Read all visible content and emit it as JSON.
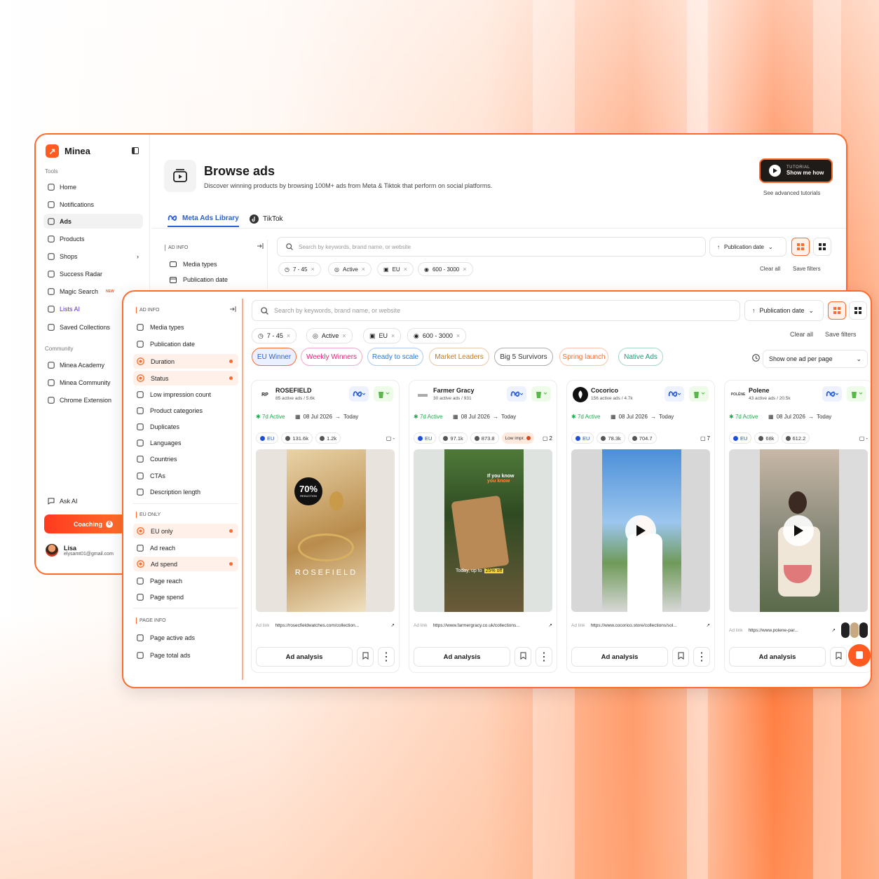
{
  "app": {
    "name": "Minea",
    "sections": {
      "tools": "Tools",
      "community": "Community"
    }
  },
  "sidebar": {
    "tools": [
      {
        "label": "Home",
        "icon": "home-icon"
      },
      {
        "label": "Notifications",
        "icon": "bell-icon"
      },
      {
        "label": "Ads",
        "icon": "ads-icon",
        "active": true
      },
      {
        "label": "Products",
        "icon": "box-icon"
      },
      {
        "label": "Shops",
        "icon": "shop-icon"
      },
      {
        "label": "Success Radar",
        "icon": "radar-icon"
      },
      {
        "label": "Magic Search",
        "icon": "wand-icon",
        "badge": "NEW"
      },
      {
        "label": "Lists AI",
        "icon": "sparkle-icon"
      },
      {
        "label": "Saved Collections",
        "icon": "collection-icon"
      }
    ],
    "community": [
      {
        "label": "Minea Academy",
        "icon": "academy-icon"
      },
      {
        "label": "Minea Community",
        "icon": "people-icon"
      },
      {
        "label": "Chrome Extension",
        "icon": "chrome-icon"
      }
    ],
    "ask_ai": "Ask AI",
    "coaching": "Coaching",
    "coaching_count": "0",
    "user": {
      "name": "Lisa",
      "email": "elysamt01@gmail.com"
    }
  },
  "header": {
    "title": "Browse ads",
    "subtitle": "Discover winning products by browsing 100M+ ads from Meta & Tiktok that perform on social platforms.",
    "tutorial_small": "TUTORIAL",
    "tutorial_big": "Show me how",
    "see_tutorials": "See advanced tutorials"
  },
  "tabs": [
    {
      "label": "Meta Ads Library",
      "active": true
    },
    {
      "label": "TikTok",
      "active": false
    }
  ],
  "filters": {
    "ad_info_title": "AD INFO",
    "ad_info": [
      {
        "label": "Media types",
        "on": false
      },
      {
        "label": "Publication date",
        "on": false
      },
      {
        "label": "Duration",
        "on": true
      },
      {
        "label": "Status",
        "on": true
      },
      {
        "label": "Low impression count",
        "on": false
      },
      {
        "label": "Product categories",
        "on": false
      },
      {
        "label": "Duplicates",
        "on": false
      },
      {
        "label": "Languages",
        "on": false
      },
      {
        "label": "Countries",
        "on": false
      },
      {
        "label": "CTAs",
        "on": false
      },
      {
        "label": "Description length",
        "on": false
      }
    ],
    "eu_title": "EU ONLY",
    "eu": [
      {
        "label": "EU only",
        "on": true
      },
      {
        "label": "Ad reach",
        "on": false
      },
      {
        "label": "Ad spend",
        "on": true
      },
      {
        "label": "Page reach",
        "on": false
      },
      {
        "label": "Page spend",
        "on": false
      }
    ],
    "page_title": "PAGE INFO",
    "page": [
      {
        "label": "Page active ads"
      },
      {
        "label": "Page total ads"
      }
    ]
  },
  "search": {
    "placeholder": "Search by keywords, brand name, or website"
  },
  "sort": {
    "label": "Publication date"
  },
  "chips": [
    "7 - 45",
    "Active",
    "EU",
    "600 - 3000"
  ],
  "clear_all": "Clear all",
  "save_filters": "Save filters",
  "quick_tags": [
    {
      "label": "EU Winner",
      "color": "#2a5fd8"
    },
    {
      "label": "Weekly Winners",
      "color": "#e0247a"
    },
    {
      "label": "Ready to scale",
      "color": "#2a7ae0"
    },
    {
      "label": "Market Leaders",
      "color": "#c07a1a"
    },
    {
      "label": "Big 5 Survivors",
      "color": "#333333"
    },
    {
      "label": "Spring launch",
      "color": "#ff6a2b"
    },
    {
      "label": "Native Ads",
      "color": "#1a9a7a"
    }
  ],
  "one_ad_per_page": "Show one ad per page",
  "cards": [
    {
      "brand": "ROSEFIELD",
      "sub": "85 active ads / 5.6k",
      "logo": "RP",
      "active": "7d Active",
      "date_from": "08 Jul 2026",
      "date_to": "Today",
      "eu": "EU",
      "reach": "131.6k",
      "spend": "1.2k",
      "low": "",
      "comments": "-",
      "link_label": "Ad link",
      "url": "https://rosecfieldwatches.com/collection...",
      "cta": "Ad analysis",
      "overlay_big": "70%",
      "overlay_small": "REDUCTION",
      "overlay_word": "ROSEFIELD"
    },
    {
      "brand": "Farmer Gracy",
      "sub": "30 active ads / 931",
      "logo": "",
      "active": "7d Active",
      "date_from": "08 Jul 2026",
      "date_to": "Today",
      "eu": "EU",
      "reach": "97.1k",
      "spend": "873.8",
      "low": "Low impr.",
      "comments": "2",
      "link_label": "Ad link",
      "url": "https://www.farmergracy.co.uk/collections...",
      "cta": "Ad analysis",
      "overlay_top": "If you know",
      "overlay_top2": "you know",
      "overlay_bottom": "Today, up to",
      "overlay_off": "25% off"
    },
    {
      "brand": "Cocorico",
      "sub": "156 active ads / 4.7k",
      "logo": "",
      "active": "7d Active",
      "date_from": "08 Jul 2026",
      "date_to": "Today",
      "eu": "EU",
      "reach": "78.3k",
      "spend": "704.7",
      "low": "",
      "comments": "7",
      "link_label": "Ad link",
      "url": "https://www.cocorico.store/collections/sol...",
      "cta": "Ad analysis"
    },
    {
      "brand": "Polene",
      "sub": "43 active ads / 20.5k",
      "logo": "POLÈNE",
      "active": "7d Active",
      "date_from": "08 Jul 2026",
      "date_to": "Today",
      "eu": "EU",
      "reach": "68k",
      "spend": "612.2",
      "low": "",
      "comments": "-",
      "link_label": "Ad link",
      "url": "https://www.polene-par...",
      "cta": "Ad analysis"
    }
  ]
}
